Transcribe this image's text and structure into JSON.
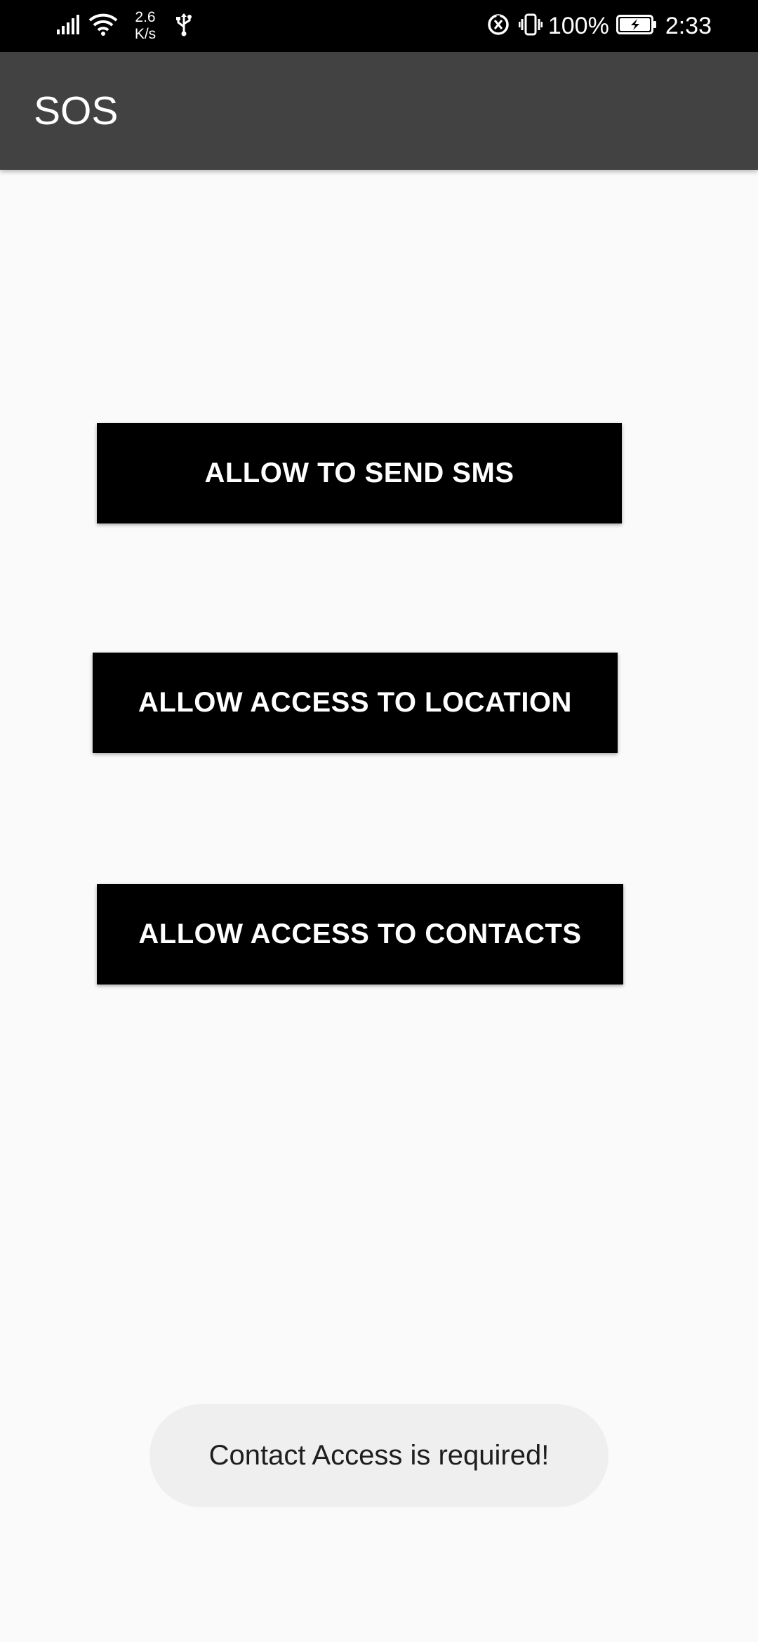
{
  "status_bar": {
    "net_speed_value": "2.6",
    "net_speed_unit": "K/s",
    "battery_percent": "100%",
    "time": "2:33",
    "icons": [
      "signal-icon",
      "wifi-icon",
      "usb-icon",
      "data-saver-icon",
      "vibrate-icon",
      "battery-charging-icon"
    ]
  },
  "app_bar": {
    "title": "SOS"
  },
  "main": {
    "buttons": [
      {
        "label": "ALLOW TO SEND SMS"
      },
      {
        "label": "ALLOW ACCESS TO LOCATION"
      },
      {
        "label": "ALLOW ACCESS TO CONTACTS"
      }
    ]
  },
  "toast": {
    "message": "Contact Access is required!"
  },
  "colors": {
    "status_bar_bg": "#000000",
    "app_bar_bg": "#424242",
    "page_bg": "#fafafa",
    "button_bg": "#000000",
    "button_text": "#ffffff",
    "toast_bg": "#efefef"
  }
}
